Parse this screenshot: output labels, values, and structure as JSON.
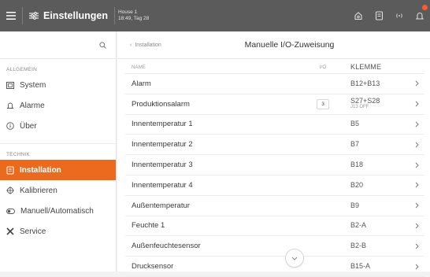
{
  "header": {
    "title": "Einstellungen",
    "house_name": "House 1",
    "datetime": "18:49, Tag 28"
  },
  "sidebar": {
    "search_icon": "search-icon",
    "sections": [
      {
        "label": "ALLGEMEIN",
        "items": [
          {
            "label": "System",
            "icon": "system-icon"
          },
          {
            "label": "Alarme",
            "icon": "bell-icon"
          },
          {
            "label": "Über",
            "icon": "info-icon"
          }
        ]
      },
      {
        "label": "TECHNIK",
        "items": [
          {
            "label": "Installation",
            "icon": "installation-icon",
            "active": true
          },
          {
            "label": "Kalibrieren",
            "icon": "calibrate-icon"
          },
          {
            "label": "Manuell/Automatisch",
            "icon": "toggle-icon"
          },
          {
            "label": "Service",
            "icon": "tools-icon"
          }
        ]
      }
    ]
  },
  "main": {
    "breadcrumb": "Installation",
    "title": "Manuelle I/O-Zuweisung",
    "columns": {
      "name": "NAME",
      "io": "I/O",
      "klemme": "KLEMME"
    },
    "rows": [
      {
        "name": "Alarm",
        "io": "",
        "klemme": "B12+B13",
        "sub": ""
      },
      {
        "name": "Produktionsalarm",
        "io": "3",
        "klemme": "S27+S28",
        "sub": "J13 OFF"
      },
      {
        "name": "Innentemperatur 1",
        "io": "",
        "klemme": "B5",
        "sub": ""
      },
      {
        "name": "Innentemperatur 2",
        "io": "",
        "klemme": "B7",
        "sub": ""
      },
      {
        "name": "Innentemperatur 3",
        "io": "",
        "klemme": "B18",
        "sub": ""
      },
      {
        "name": "Innentemperatur 4",
        "io": "",
        "klemme": "B20",
        "sub": ""
      },
      {
        "name": "Außentemperatur",
        "io": "",
        "klemme": "B9",
        "sub": ""
      },
      {
        "name": "Feuchte 1",
        "io": "",
        "klemme": "B2-A",
        "sub": ""
      },
      {
        "name": "Außenfeuchtesensor",
        "io": "",
        "klemme": "B2-B",
        "sub": ""
      },
      {
        "name": "Drucksensor",
        "io": "",
        "klemme": "B15-A",
        "sub": ""
      }
    ]
  },
  "colors": {
    "topbar": "#5b5b5b",
    "accent": "#ec6a1d",
    "badge": "#ff5a2a"
  }
}
